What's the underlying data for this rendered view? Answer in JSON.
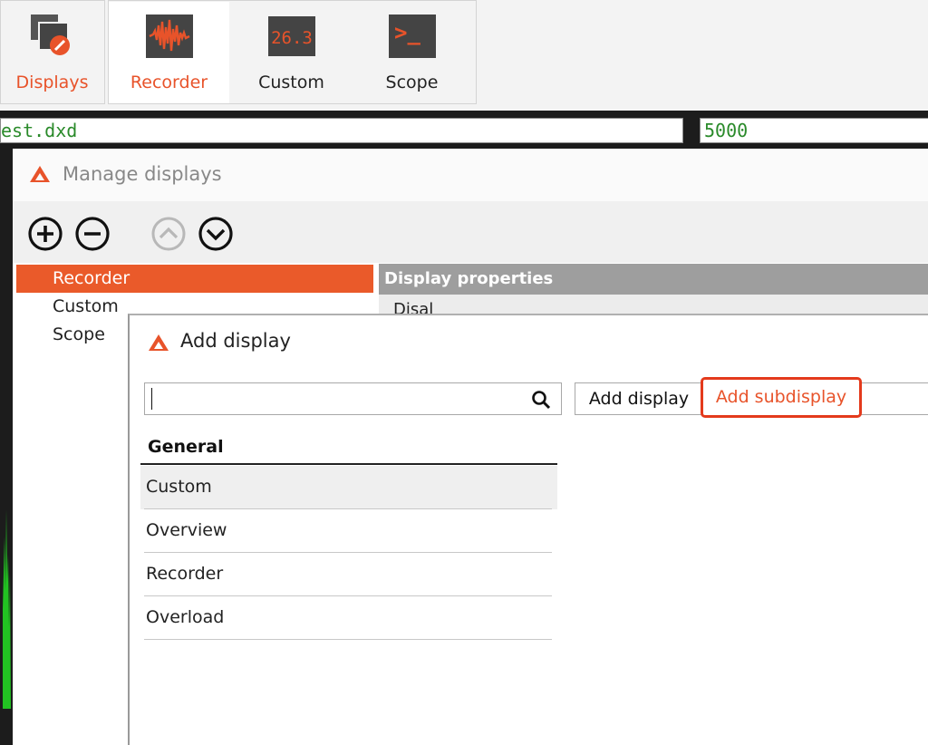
{
  "ribbon": {
    "buttons": [
      {
        "label": "Displays",
        "icon": "displays-icon"
      },
      {
        "label": "Recorder",
        "icon": "recorder-waveform-icon"
      },
      {
        "label": "Custom",
        "icon": "custom-numeric-icon",
        "icon_text": "26.3"
      },
      {
        "label": "Scope",
        "icon": "scope-terminal-icon",
        "icon_text": ">_"
      }
    ]
  },
  "inputs": {
    "file_value": "est.dxd",
    "rate_value": "5000"
  },
  "manage_displays": {
    "title": "Manage displays",
    "toolbar": [
      "add-circle-icon",
      "remove-circle-icon",
      "move-up-icon",
      "move-down-icon"
    ],
    "tree": [
      "Recorder",
      "Custom",
      "Scope"
    ],
    "properties_header": "Display properties",
    "properties_body": "Disal"
  },
  "add_display": {
    "title": "Add display",
    "search_placeholder": "",
    "add_display_label": "Add display",
    "add_subdisplay_label": "Add subdisplay",
    "group": "General",
    "items": [
      "Custom",
      "Overview",
      "Recorder",
      "Overload"
    ]
  },
  "colors": {
    "accent": "#ea5a2a",
    "highlight_border": "#e43a1c",
    "green_text": "#2a8a2a"
  }
}
